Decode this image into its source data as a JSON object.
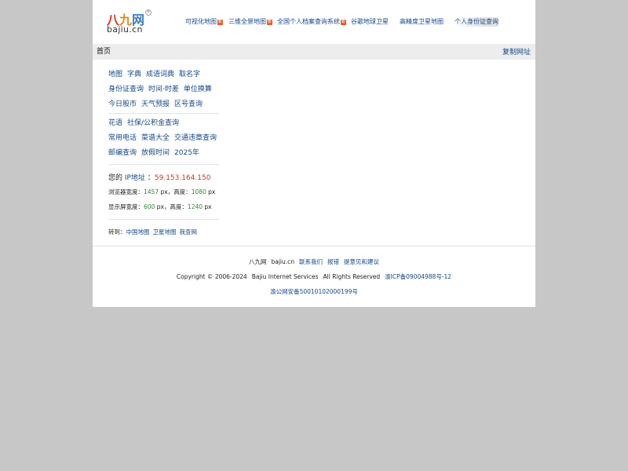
{
  "logo": {
    "cn_1": "八",
    "cn_2": "九",
    "cn_3": "网",
    "reg": "®",
    "en": "bajiu.cn"
  },
  "topnav": [
    {
      "label": "可视化地图",
      "badge": "新"
    },
    {
      "label": "三维全景地图",
      "badge": "新"
    },
    {
      "label": "全国个人档案查询系统",
      "badge": "新"
    },
    {
      "label": "谷歌地球卫星",
      "badge": ""
    },
    {
      "label": "高精度卫星地图",
      "badge": ""
    },
    {
      "label": "个人身份证查询",
      "badge": ""
    }
  ],
  "bar": {
    "home": "首页",
    "copy_url": "复制网址"
  },
  "links": {
    "row1": [
      "地图",
      "字典",
      "成语词典",
      "取名字"
    ],
    "row2": [
      "身份证查询",
      "时间·时差",
      "单位换算"
    ],
    "row3": [
      "今日股市",
      "天气预报",
      "区号查询"
    ],
    "row4": [
      "花语",
      "社保/公积金查询"
    ],
    "row5": [
      "常用电话",
      "菜谱大全",
      "交通违章查询"
    ],
    "row6": [
      "邮编查询",
      "放假时间",
      "2025年"
    ]
  },
  "ip": {
    "prefix": "您的",
    "label": "IP地址",
    "colon": "：",
    "value": "59.153.164.150"
  },
  "browser": {
    "label_w": "浏览器宽度：",
    "w": "1457",
    "px1": " px，",
    "label_h": "高度：",
    "h": "1080",
    "px2": " px"
  },
  "screen": {
    "label_w": "显示屏宽度：",
    "w": "600",
    "px1": " px，",
    "label_h": "高度：",
    "h": "1240",
    "px2": " px"
  },
  "goto": {
    "label": "转到：",
    "links": [
      "中国地图",
      "卫星地图",
      "我查网"
    ]
  },
  "footer": {
    "line1": {
      "site": "八九网",
      "domain": "bajiu.cn",
      "links": [
        "联系我们",
        "报错",
        "提意见和建议"
      ]
    },
    "line2": {
      "copyright": "Copyright © 2006-2024",
      "company": "Bajiu Internet Services",
      "rights": "All Rights Reserved",
      "icp": "渝ICP备09004988号-12"
    },
    "line3": {
      "police": "渝公网安备50010102000199号"
    }
  }
}
